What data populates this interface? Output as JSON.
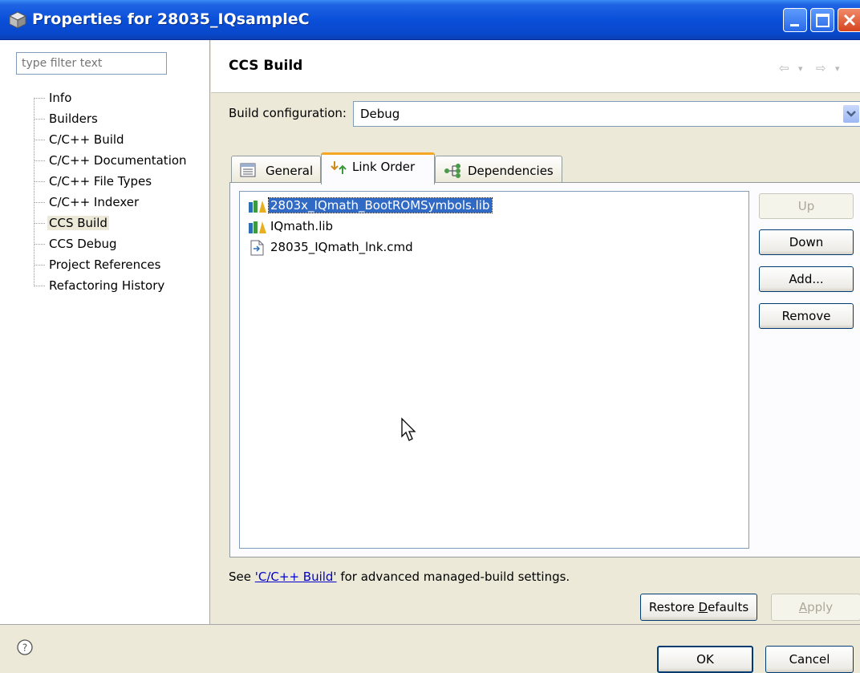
{
  "window": {
    "title": "Properties for 28035_IQsampleC"
  },
  "filter": {
    "placeholder": "type filter text"
  },
  "tree": {
    "items": [
      {
        "label": "Info"
      },
      {
        "label": "Builders"
      },
      {
        "label": "C/C++ Build"
      },
      {
        "label": "C/C++ Documentation"
      },
      {
        "label": "C/C++ File Types"
      },
      {
        "label": "C/C++ Indexer"
      },
      {
        "label": "CCS Build"
      },
      {
        "label": "CCS Debug"
      },
      {
        "label": "Project References"
      },
      {
        "label": "Refactoring History"
      }
    ],
    "selected": "CCS Build"
  },
  "page": {
    "title": "CCS Build",
    "nav_back": "⇦",
    "nav_back_menu": "▾",
    "nav_forward": "⇨",
    "nav_forward_menu": "▾"
  },
  "config": {
    "label": "Build configuration:",
    "value": "Debug"
  },
  "tabs": [
    {
      "label": "General",
      "icon": "list-icon"
    },
    {
      "label": "Link Order",
      "icon": "link-order-icon"
    },
    {
      "label": "Dependencies",
      "icon": "dependencies-icon"
    }
  ],
  "active_tab": "Link Order",
  "link_order": {
    "items": [
      {
        "label": "2803x_IQmath_BootROMSymbols.lib",
        "icon": "library-icon"
      },
      {
        "label": "IQmath.lib",
        "icon": "library-icon"
      },
      {
        "label": "28035_IQmath_lnk.cmd",
        "icon": "command-file-icon"
      }
    ],
    "selected": "2803x_IQmath_BootROMSymbols.lib"
  },
  "side_buttons": {
    "up": "Up",
    "down": "Down",
    "add": "Add...",
    "remove": "Remove"
  },
  "footer_note": {
    "prefix": "See ",
    "link": "'C/C++ Build'",
    "suffix": " for advanced managed-build settings."
  },
  "buttons": {
    "restore_prefix": "Restore ",
    "restore_mnemonic": "D",
    "restore_suffix": "efaults",
    "apply_mnemonic": "A",
    "apply_suffix": "pply",
    "ok": "OK",
    "cancel": "Cancel"
  },
  "colors": {
    "selection": "#316ac5",
    "titlebar": "#0a4fd8",
    "tab_highlight": "#f5a623"
  }
}
